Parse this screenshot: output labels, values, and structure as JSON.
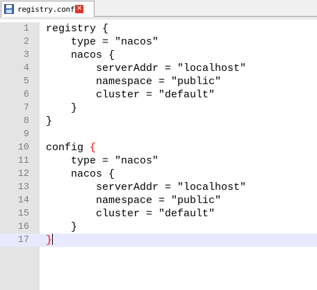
{
  "tab": {
    "filename": "registry.conf",
    "save_icon": "save-icon",
    "close_icon": "close-icon",
    "close_glyph": "✕"
  },
  "editor": {
    "lines": [
      {
        "n": "1",
        "text": "registry {"
      },
      {
        "n": "2",
        "text": "    type = \"nacos\""
      },
      {
        "n": "3",
        "text": "    nacos {"
      },
      {
        "n": "4",
        "text": "        serverAddr = \"localhost\""
      },
      {
        "n": "5",
        "text": "        namespace = \"public\""
      },
      {
        "n": "6",
        "text": "        cluster = \"default\""
      },
      {
        "n": "7",
        "text": "    }"
      },
      {
        "n": "8",
        "text": "}"
      },
      {
        "n": "9",
        "text": ""
      },
      {
        "n": "10",
        "text": "config ",
        "brace": "{"
      },
      {
        "n": "11",
        "text": "    type = \"nacos\""
      },
      {
        "n": "12",
        "text": "    nacos {"
      },
      {
        "n": "13",
        "text": "        serverAddr = \"localhost\""
      },
      {
        "n": "14",
        "text": "        namespace = \"public\""
      },
      {
        "n": "15",
        "text": "        cluster = \"default\""
      },
      {
        "n": "16",
        "text": "    }"
      },
      {
        "n": "17",
        "text": "",
        "brace": "}",
        "current": true
      }
    ]
  },
  "colors": {
    "matched_brace": "#ff0000",
    "current_line_bg": "#e8e8ff",
    "gutter_bg": "#e4e4e4",
    "line_number": "#808080"
  }
}
